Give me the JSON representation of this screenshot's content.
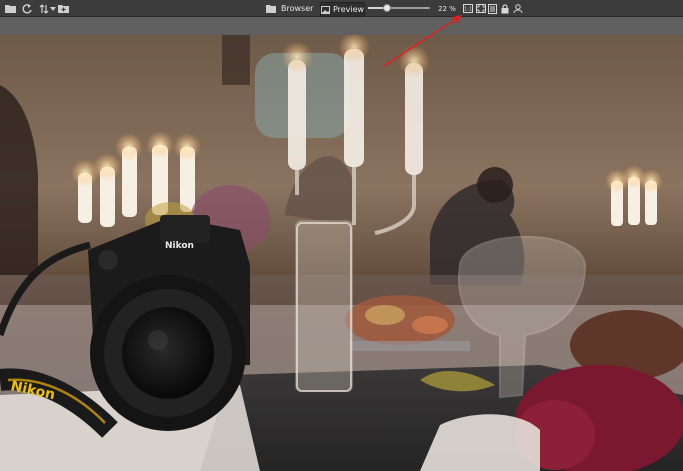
{
  "toolbar": {
    "browser_label": "Browser",
    "preview_label": "Preview",
    "zoom_label": "22 %",
    "zoom_slider_level": 0.3,
    "icons": [
      "folder-icon",
      "refresh-icon",
      "sort-icon",
      "dropdown-icon",
      "folder-add-icon",
      "browser-folder-icon",
      "chevron-down-icon",
      "preview-image-icon",
      "one-to-one-icon",
      "fit-screen-icon",
      "compare-icon",
      "lock-icon",
      "user-settings-icon"
    ]
  },
  "colors": {
    "toolbar_bg": "#3c3c3c",
    "annotation_arrow": "#e02020"
  }
}
